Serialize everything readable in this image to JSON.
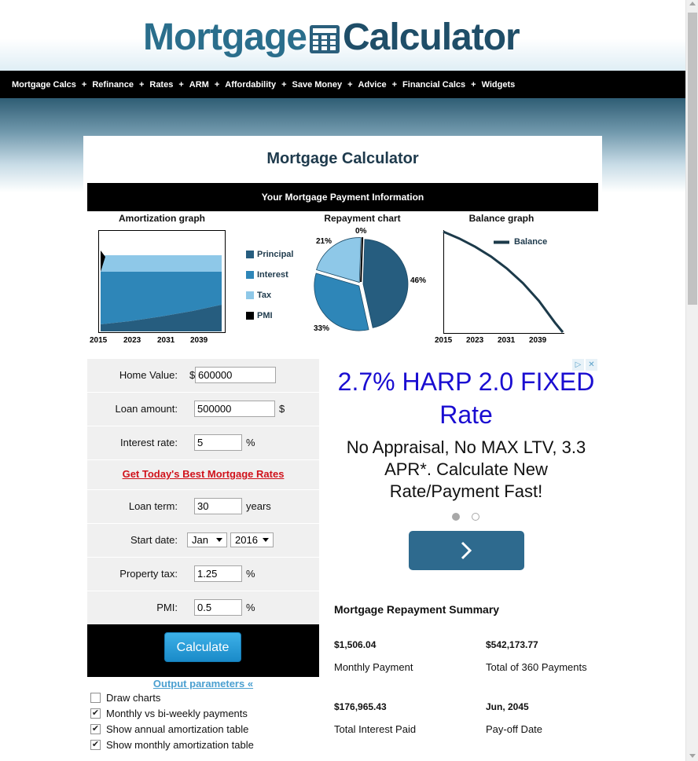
{
  "logo": {
    "word1": "Mortgage",
    "word2": "Calculator"
  },
  "nav": [
    "Mortgage Calcs",
    "Refinance",
    "Rates",
    "ARM",
    "Affordability",
    "Save Money",
    "Advice",
    "Financial Calcs",
    "Widgets"
  ],
  "nav_separator": "+",
  "main_title": "Mortgage Calculator",
  "info_bar": "Your Mortgage Payment Information",
  "graphs": {
    "amortization_title": "Amortization graph",
    "repayment_title": "Repayment chart",
    "balance_title": "Balance graph",
    "years": [
      "2015",
      "2023",
      "2031",
      "2039"
    ],
    "legend": [
      {
        "label": "Principal",
        "color": "#265d7f"
      },
      {
        "label": "Interest",
        "color": "#2e86b8"
      },
      {
        "label": "Tax",
        "color": "#8ec8e8"
      },
      {
        "label": "PMI",
        "color": "#000000"
      }
    ],
    "balance_legend": "Balance"
  },
  "chart_data": [
    {
      "type": "area",
      "title": "Amortization graph",
      "x_ticks": [
        "2015",
        "2023",
        "2031",
        "2039"
      ],
      "series": [
        {
          "name": "Principal"
        },
        {
          "name": "Interest"
        },
        {
          "name": "Tax"
        },
        {
          "name": "PMI"
        }
      ]
    },
    {
      "type": "pie",
      "title": "Repayment chart",
      "slices": [
        {
          "name": "Principal",
          "value": 46,
          "label": "46%",
          "color": "#265d7f"
        },
        {
          "name": "Interest",
          "value": 33,
          "label": "33%",
          "color": "#2e86b8"
        },
        {
          "name": "Tax",
          "value": 21,
          "label": "21%",
          "color": "#8ec8e8"
        },
        {
          "name": "PMI",
          "value": 0,
          "label": "0%",
          "color": "#000000"
        }
      ]
    },
    {
      "type": "line",
      "title": "Balance graph",
      "x_ticks": [
        "2015",
        "2023",
        "2031",
        "2039"
      ],
      "series": [
        {
          "name": "Balance",
          "x": [
            2015,
            2019,
            2023,
            2027,
            2031,
            2035,
            2039,
            2043,
            2045
          ],
          "y": [
            500000,
            466000,
            425000,
            376000,
            316000,
            244000,
            156000,
            48000,
            0
          ]
        }
      ]
    }
  ],
  "form": {
    "home_value_label": "Home Value:",
    "home_value_prefix": "$",
    "home_value": "600000",
    "loan_amount_label": "Loan amount:",
    "loan_amount": "500000",
    "loan_amount_unit": "$",
    "interest_rate_label": "Interest rate:",
    "interest_rate": "5",
    "interest_rate_unit": "%",
    "rates_link": "Get Today's Best Mortgage Rates",
    "loan_term_label": "Loan term:",
    "loan_term": "30",
    "loan_term_unit": "years",
    "start_date_label": "Start date:",
    "start_month": "Jan",
    "start_year": "2016",
    "property_tax_label": "Property tax:",
    "property_tax": "1.25",
    "property_tax_unit": "%",
    "pmi_label": "PMI:",
    "pmi": "0.5",
    "pmi_unit": "%",
    "calculate": "Calculate",
    "output_params": "Output parameters «",
    "options": [
      {
        "label": "Draw charts",
        "checked": false
      },
      {
        "label": "Monthly vs bi-weekly payments",
        "checked": true
      },
      {
        "label": "Show annual amortization table",
        "checked": true
      },
      {
        "label": "Show monthly amortization table",
        "checked": true
      }
    ]
  },
  "ad": {
    "headline": "2.7% HARP 2.0 FIXED Rate",
    "body": "No Appraisal, No MAX LTV, 3.3 APR*. Calculate New Rate/Payment Fast!",
    "choice_icons": [
      "▷",
      "✕"
    ]
  },
  "summary": {
    "title": "Mortgage Repayment Summary",
    "monthly_payment_value": "$1,506.04",
    "monthly_payment_label": "Monthly Payment",
    "total_payments_value": "$542,173.77",
    "total_payments_label": "Total of 360 Payments",
    "total_interest_value": "$176,965.43",
    "total_interest_label": "Total Interest Paid",
    "payoff_value": "Jun, 2045",
    "payoff_label": "Pay-off Date"
  }
}
